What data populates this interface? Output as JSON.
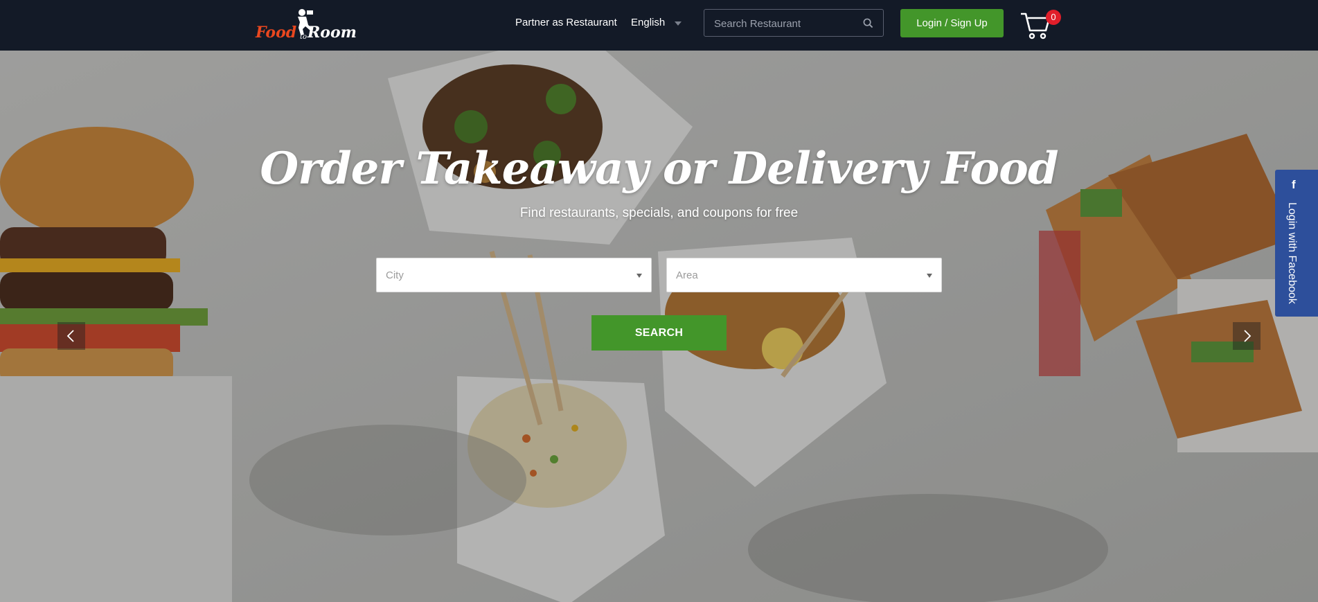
{
  "header": {
    "logo": {
      "text_food": "Food",
      "text_to": "to",
      "text_room": "Room"
    },
    "nav": {
      "partner": "Partner as Restaurant",
      "language": "English"
    },
    "search": {
      "placeholder": "Search Restaurant",
      "icon": "search-icon"
    },
    "login_label": "Login / Sign Up",
    "cart": {
      "icon": "cart-icon",
      "count": "0"
    }
  },
  "hero": {
    "title": "Order Takeaway or Delivery Food",
    "subtitle": "Find restaurants, specials, and coupons for free",
    "city_select": {
      "placeholder": "City"
    },
    "area_select": {
      "placeholder": "Area"
    },
    "search_button": "SEARCH",
    "carousel": {
      "prev_icon": "chevron-left-icon",
      "next_icon": "chevron-right-icon"
    }
  },
  "social": {
    "facebook_label": "Login with Facebook",
    "icon": "facebook-icon"
  },
  "colors": {
    "header_bg": "#131a27",
    "brand_green": "#43962a",
    "logo_orange": "#e8471f",
    "badge_red": "#e01e2a",
    "facebook_blue": "#2d4f9b"
  }
}
